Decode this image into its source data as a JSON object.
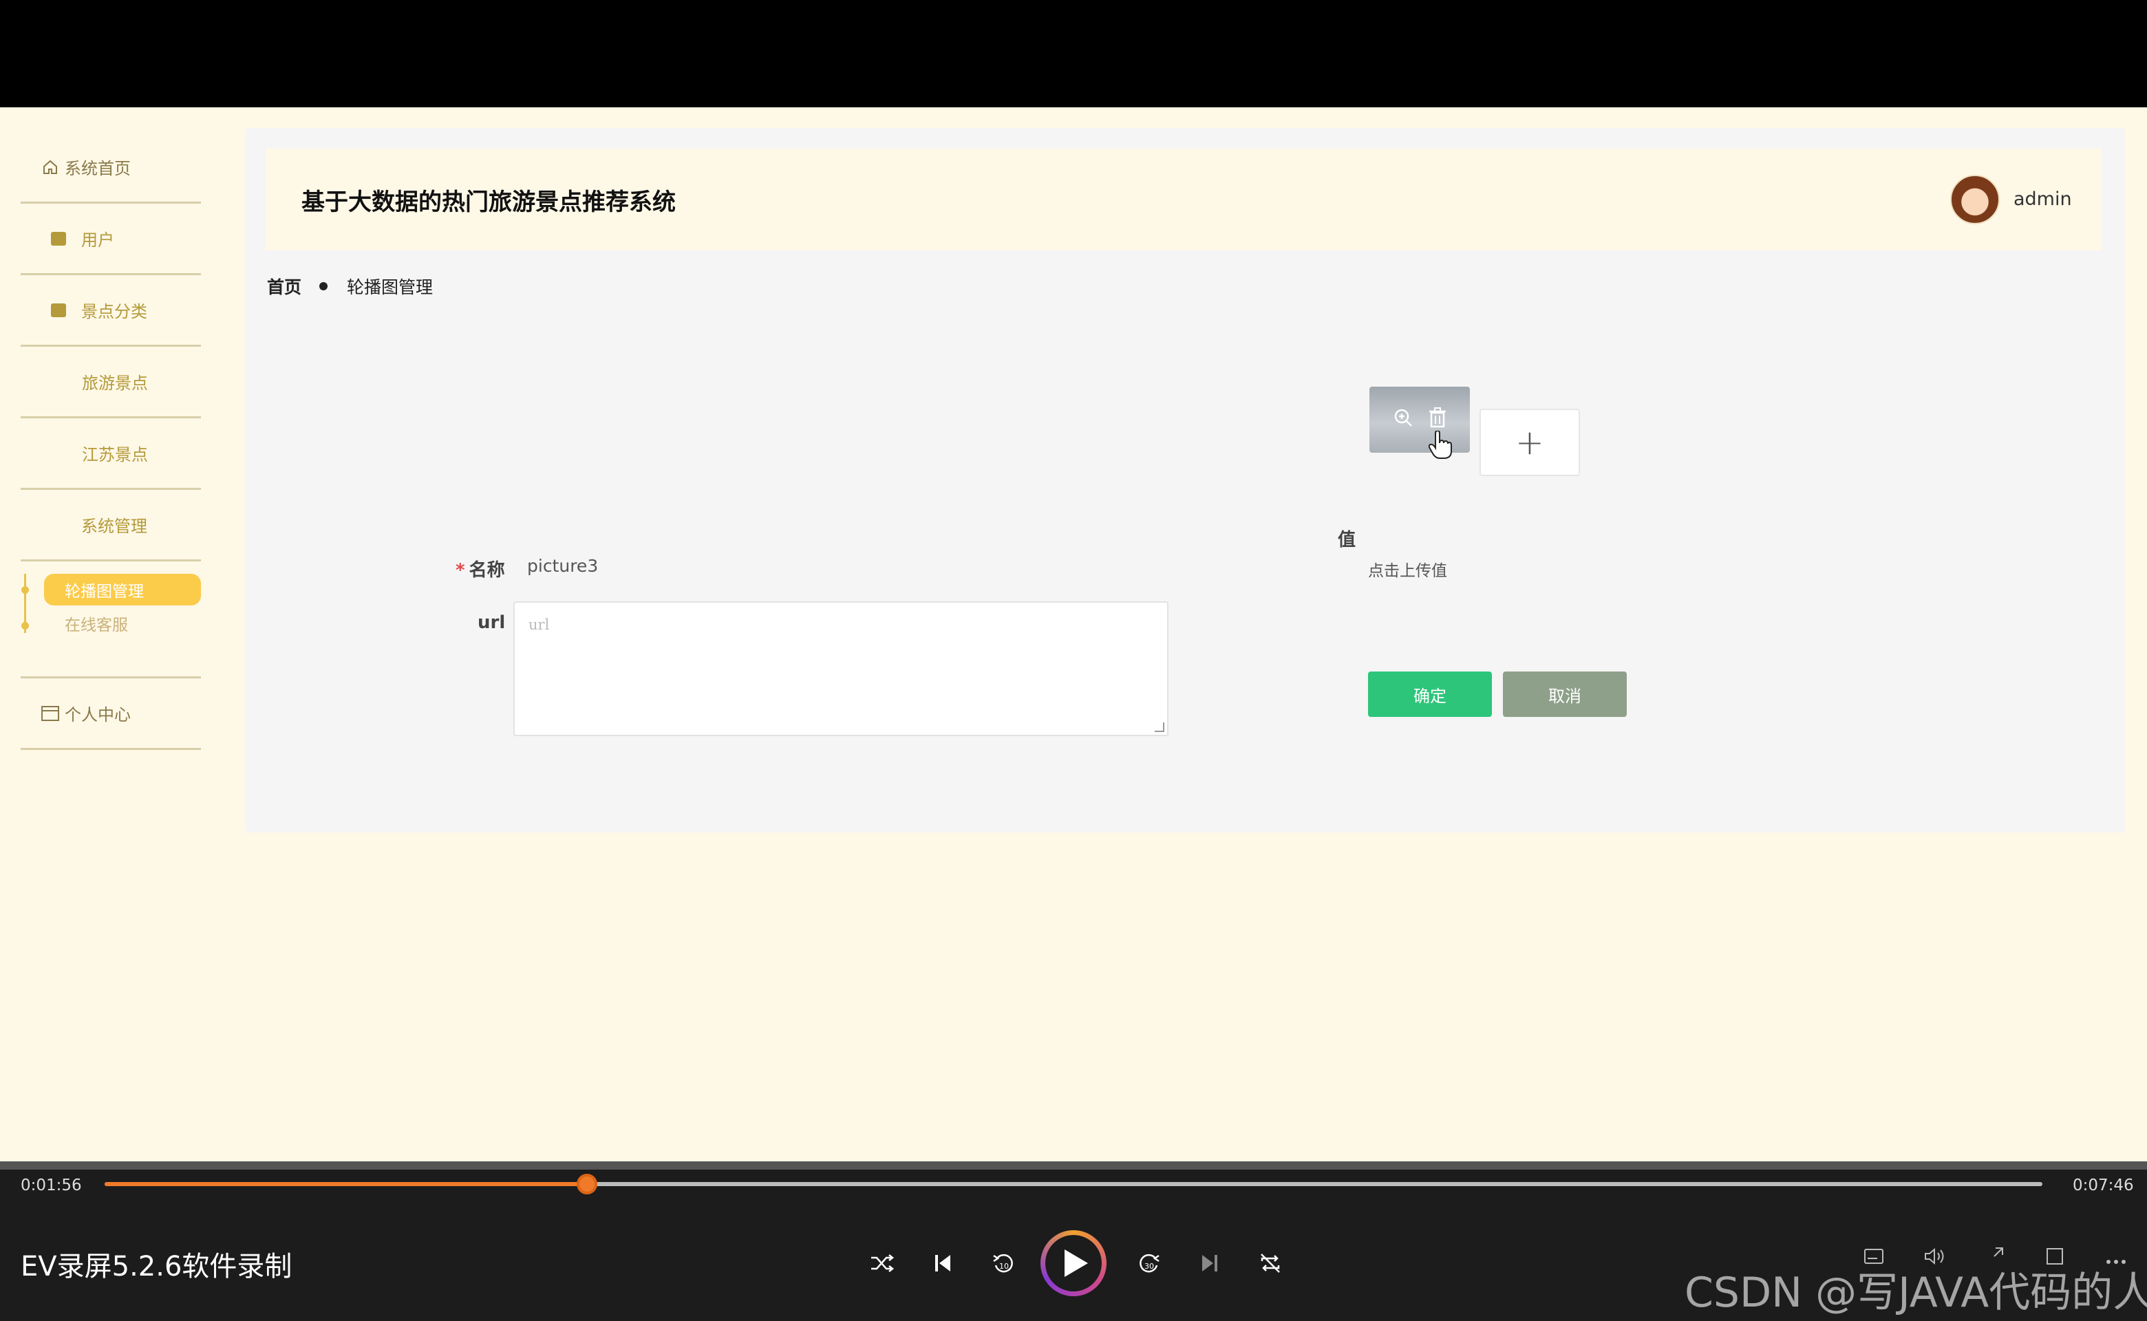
{
  "app": {
    "title": "基于大数据的热门旅游景点推荐系统",
    "user": "admin"
  },
  "sidebar": {
    "items": [
      {
        "label": "系统首页",
        "icon": "home-icon"
      },
      {
        "label": "用户",
        "icon": "chart-icon"
      },
      {
        "label": "景点分类",
        "icon": "chat-icon"
      },
      {
        "label": "旅游景点",
        "icon": "grid-icon"
      },
      {
        "label": "江苏景点",
        "icon": "grid-icon"
      },
      {
        "label": "系统管理",
        "icon": "menu-icon"
      },
      {
        "label": "个人中心",
        "icon": "card-icon"
      }
    ],
    "sub": [
      {
        "label": "轮播图管理",
        "active": true
      },
      {
        "label": "在线客服",
        "active": false
      }
    ]
  },
  "breadcrumb": {
    "home": "首页",
    "current": "轮播图管理"
  },
  "form": {
    "name_label": "名称",
    "required_mark": "*",
    "name_value": "picture3",
    "url_label": "url",
    "url_placeholder": "url",
    "value_label": "值",
    "upload_plus": "+",
    "upload_hint": "点击上传值",
    "confirm": "确定",
    "cancel": "取消"
  },
  "player": {
    "elapsed": "0:01:56",
    "total": "0:07:46",
    "progress": 0.2489,
    "recorder_title": "EV录屏5.2.6软件录制",
    "watermark": "CSDN @写JAVA代码的人",
    "accent": "#f07a2a"
  }
}
